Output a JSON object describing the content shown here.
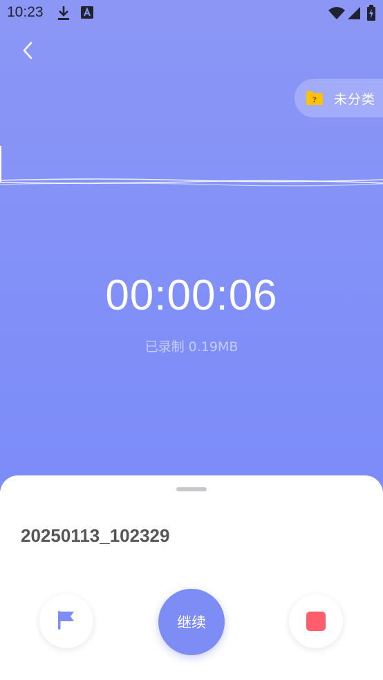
{
  "status_bar": {
    "time": "10:23",
    "icons": [
      "download-icon",
      "app-notification-icon",
      "wifi-icon",
      "signal-icon",
      "battery-icon"
    ]
  },
  "header": {
    "back_icon": "chevron-left-icon",
    "category_label": "未分类",
    "category_icon": "unknown-folder-icon"
  },
  "recording": {
    "elapsed": "00:00:06",
    "recorded_size": "已录制 0.19MB"
  },
  "sheet": {
    "filename": "20250113_102329",
    "mark_icon": "flag-icon",
    "continue_label": "继续",
    "stop_icon": "stop-icon"
  },
  "colors": {
    "accent": "#7E8CF6",
    "stop": "#FF5F6D",
    "folder": "#FFC107"
  }
}
